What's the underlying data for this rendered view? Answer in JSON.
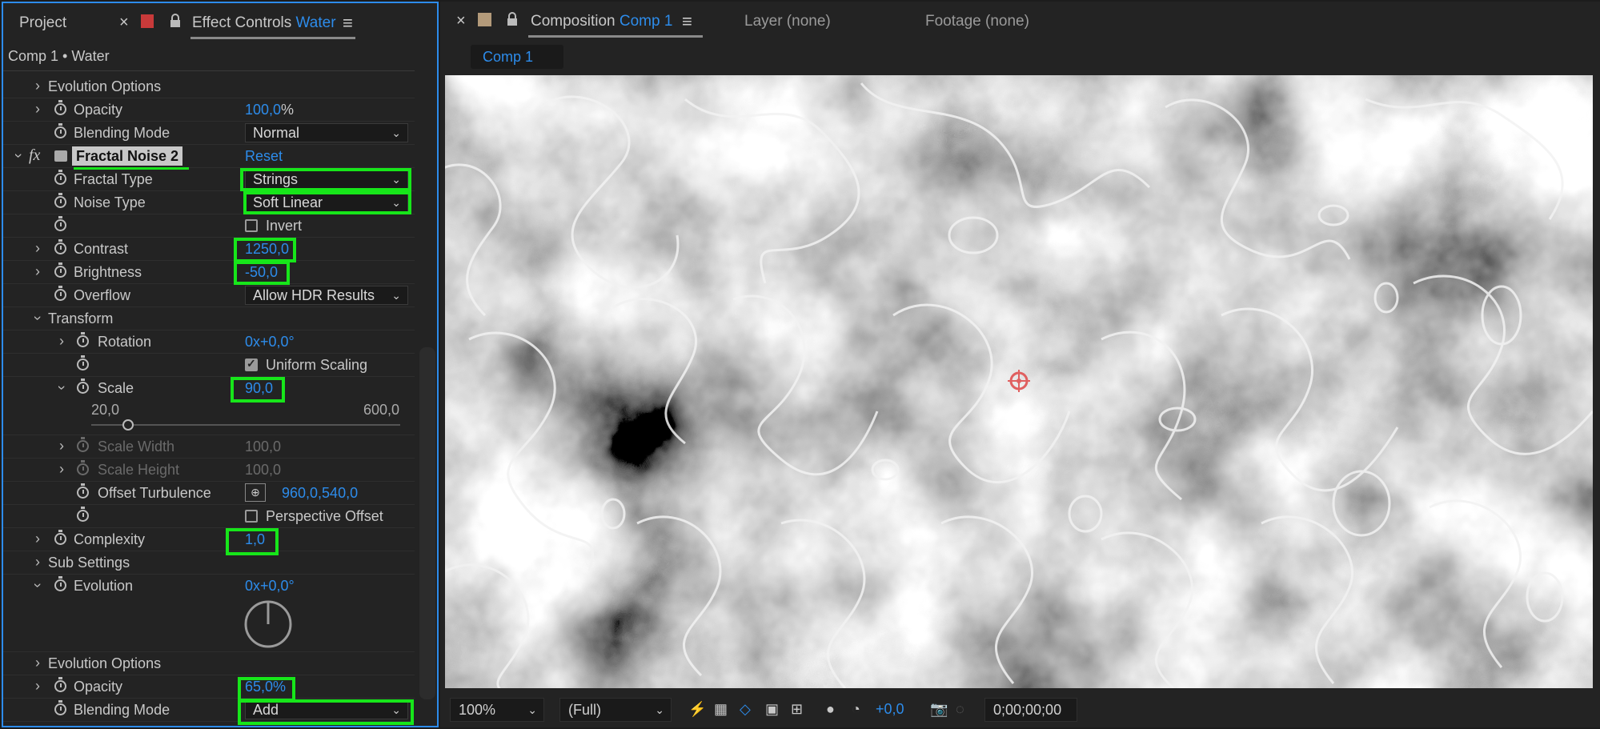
{
  "left_panel": {
    "tabs": {
      "project": "Project",
      "close": "×",
      "effect_controls": "Effect Controls",
      "effect_controls_layer": "Water",
      "menu": "≡"
    },
    "header": "Comp 1 • Water",
    "rows": {
      "evo_opts_1": "Evolution Options",
      "opacity_1_label": "Opacity",
      "opacity_1_value": "100,0",
      "opacity_1_unit": "%",
      "blend_1_label": "Blending Mode",
      "blend_1_value": "Normal",
      "fx_label": "fx",
      "effect_name": "Fractal Noise 2",
      "reset": "Reset",
      "fractal_type_label": "Fractal Type",
      "fractal_type_value": "Strings",
      "noise_type_label": "Noise Type",
      "noise_type_value": "Soft Linear",
      "invert_label": "Invert",
      "contrast_label": "Contrast",
      "contrast_value": "1250,0",
      "brightness_label": "Brightness",
      "brightness_value": "-50,0",
      "overflow_label": "Overflow",
      "overflow_value": "Allow HDR Results",
      "transform_label": "Transform",
      "rotation_label": "Rotation",
      "rotation_value": "0x+0,0°",
      "uniform_scaling_label": "Uniform Scaling",
      "scale_label": "Scale",
      "scale_value": "90,0",
      "scale_min": "20,0",
      "scale_max": "600,0",
      "scale_width_label": "Scale Width",
      "scale_width_value": "100,0",
      "scale_height_label": "Scale Height",
      "scale_height_value": "100,0",
      "offset_label": "Offset Turbulence",
      "offset_value": "960,0,540,0",
      "perspective_label": "Perspective Offset",
      "complexity_label": "Complexity",
      "complexity_value": "1,0",
      "sub_settings_label": "Sub Settings",
      "evolution_label": "Evolution",
      "evolution_value": "0x+0,0°",
      "evo_opts_2": "Evolution Options",
      "opacity_2_label": "Opacity",
      "opacity_2_value": "65,0%",
      "blend_2_label": "Blending Mode",
      "blend_2_value": "Add"
    },
    "scale_slider_fraction": 0.12
  },
  "right_panel": {
    "tabs": {
      "close": "×",
      "composition": "Composition",
      "comp_name": "Comp 1",
      "menu": "≡",
      "layer": "Layer (none)",
      "footage": "Footage (none)"
    },
    "subtab": "Comp 1",
    "bottom_bar": {
      "zoom": "100%",
      "resolution": "(Full)",
      "exposure": "+0,0",
      "timecode": "0;00;00;00"
    }
  },
  "colors": {
    "accent_blue": "#2d8ceb",
    "highlight_green": "#17e61a",
    "panel_bg": "#232323"
  }
}
